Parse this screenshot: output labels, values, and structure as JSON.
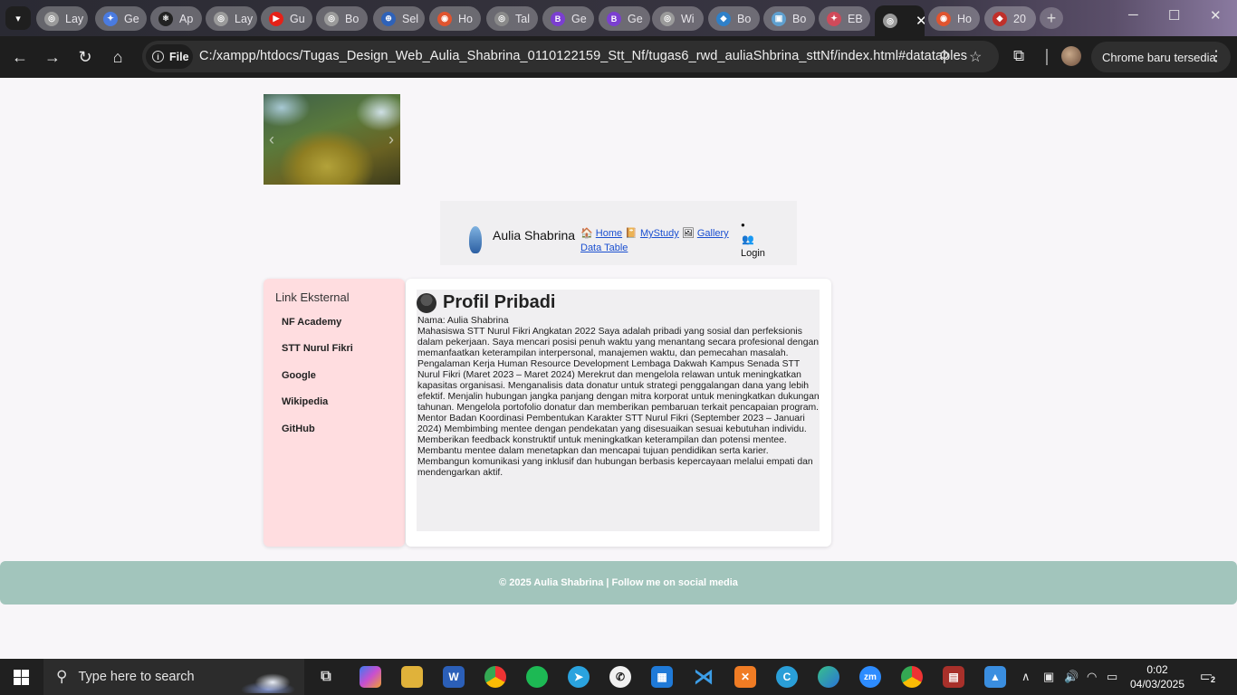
{
  "browser": {
    "tabs": [
      {
        "title": "Lay",
        "color": "#9b9b9b",
        "glyph": "◎"
      },
      {
        "title": "Ge",
        "color": "#4a7be0",
        "glyph": "✦"
      },
      {
        "title": "Ap",
        "color": "#222222",
        "glyph": "⚛"
      },
      {
        "title": "Lay",
        "color": "#9b9b9b",
        "glyph": "◎"
      },
      {
        "title": "Gu",
        "color": "#e62117",
        "glyph": "▶"
      },
      {
        "title": "Bo",
        "color": "#9b9b9b",
        "glyph": "◎"
      },
      {
        "title": "Sel",
        "color": "#2f62b8",
        "glyph": "⊕"
      },
      {
        "title": "Ho",
        "color": "#e0542f",
        "glyph": "◉"
      },
      {
        "title": "Tal",
        "color": "#8a8a8a",
        "glyph": "◎"
      },
      {
        "title": "Ge",
        "color": "#7b3fd0",
        "glyph": "B"
      },
      {
        "title": "Ge",
        "color": "#7b3fd0",
        "glyph": "B"
      },
      {
        "title": "Wi",
        "color": "#9b9b9b",
        "glyph": "◎"
      },
      {
        "title": "Bo",
        "color": "#2f80c8",
        "glyph": "◆"
      },
      {
        "title": "Bo",
        "color": "#5fa0d0",
        "glyph": "▣"
      },
      {
        "title": "EB",
        "color": "#d04a5a",
        "glyph": "✦"
      },
      {
        "title": "",
        "color": "#9b9b9b",
        "glyph": "◎",
        "active": true
      },
      {
        "title": "Ho",
        "color": "#e0542f",
        "glyph": "◉"
      },
      {
        "title": "20",
        "color": "#c0302a",
        "glyph": "◆"
      }
    ],
    "active_close": "✕",
    "new_tab": "+",
    "chip_label": "File",
    "url": "C:/xampp/htdocs/Tugas_Design_Web_Aulia_Shabrina_0110122159_Stt_Nf/tugas6_rwd_auliaShbrina_sttNf/index.html#datatables",
    "update_label": "Chrome baru tersedia"
  },
  "page": {
    "brand": "Aulia Shabrina",
    "nav": {
      "home": "Home",
      "mystudy": "MyStudy",
      "gallery": "Gallery",
      "datatable": "Data Table",
      "login": "Login",
      "home_icon": "🏠",
      "mystudy_icon": "📔",
      "gallery_icon": "🖼",
      "login_icon": "👥"
    },
    "sidebar": {
      "title": "Link Eksternal",
      "links": [
        "NF Academy",
        "STT Nurul Fikri",
        "Google",
        "Wikipedia",
        "GitHub"
      ]
    },
    "profile": {
      "heading": "Profil Pribadi",
      "name_line": "Nama: Aulia Shabrina",
      "about": "Mahasiswa STT Nurul Fikri Angkatan 2022 Saya adalah pribadi yang sosial dan perfeksionis dalam pekerjaan. Saya mencari posisi penuh waktu yang menantang secara profesional dengan memanfaatkan keterampilan interpersonal, manajemen waktu, dan pemecahan masalah.",
      "experience": "Pengalaman Kerja Human Resource Development Lembaga Dakwah Kampus Senada STT Nurul Fikri (Maret 2023 – Maret 2024) Merekrut dan mengelola relawan untuk meningkatkan kapasitas organisasi. Menganalisis data donatur untuk strategi penggalangan dana yang lebih efektif. Menjalin hubungan jangka panjang dengan mitra korporat untuk meningkatkan dukungan tahunan. Mengelola portofolio donatur dan memberikan pembaruan terkait pencapaian program. Mentor Badan Koordinasi Pembentukan Karakter STT Nurul Fikri (September 2023 – Januari 2024) Membimbing mentee dengan pendekatan yang disesuaikan sesuai kebutuhan individu. Memberikan feedback konstruktif untuk meningkatkan keterampilan dan potensi mentee. Membantu mentee dalam menetapkan dan mencapai tujuan pendidikan serta karier. Membangun komunikasi yang inklusif dan hubungan berbasis kepercayaan melalui empati dan mendengarkan aktif."
    },
    "footer": "© 2025 Aulia Shabrina | Follow me on social media"
  },
  "taskbar": {
    "search_placeholder": "Type here to search",
    "time": "0:02",
    "date": "04/03/2025",
    "notifications": "2"
  }
}
